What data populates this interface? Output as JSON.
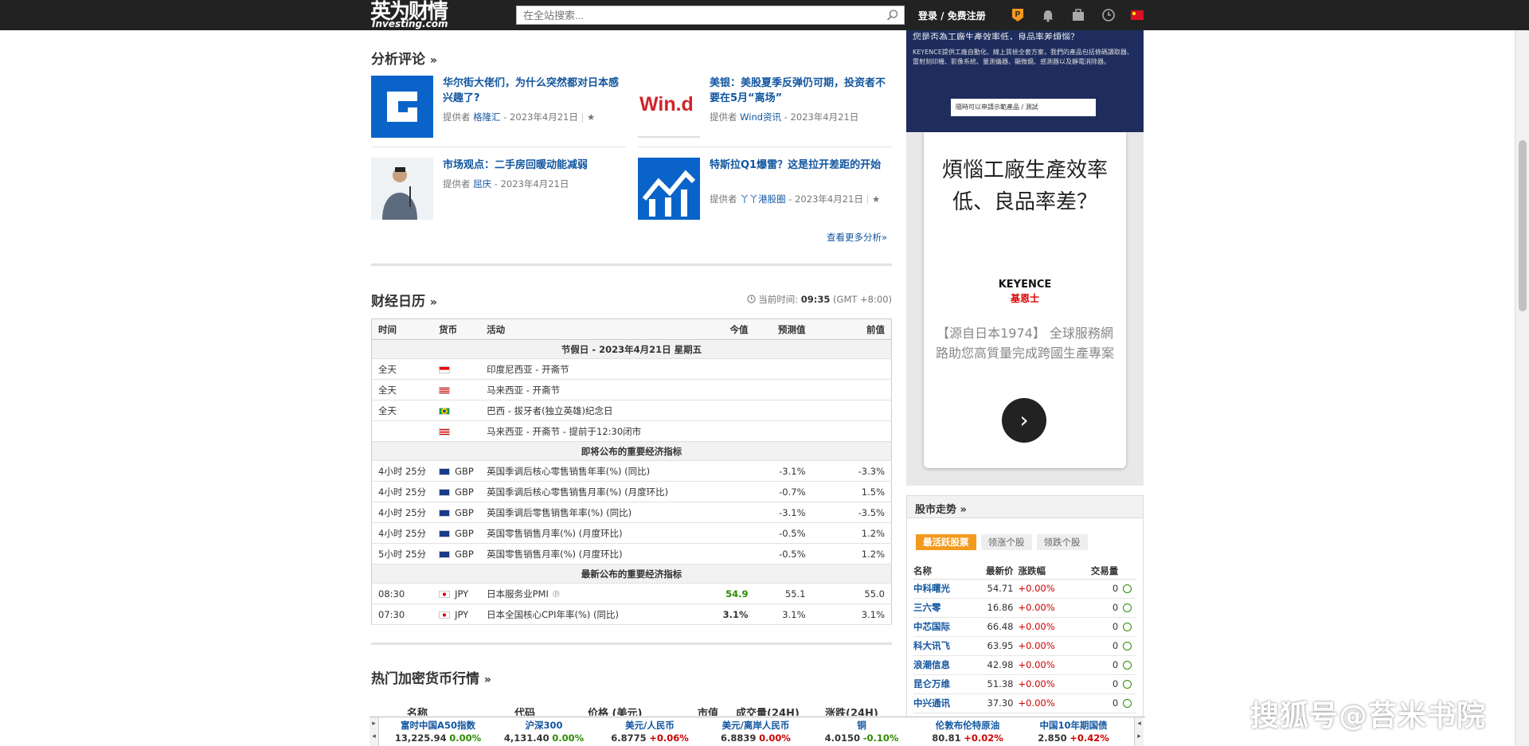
{
  "header": {
    "logo_cn": "英为财情",
    "logo_en": "Investing.com",
    "search_placeholder": "在全站搜索...",
    "login_label": "登录 / 免费注册"
  },
  "analysis": {
    "title": "分析评论",
    "arrow": "»",
    "more": "查看更多分析»",
    "articles": [
      {
        "title": "华尔街大佬们，为什么突然都对日本感兴趣了?",
        "by": "提供者",
        "author": "格隆汇",
        "date": " - 2023年4月21日",
        "thumb": "G"
      },
      {
        "title": "美银：美股夏季反弹仍可期，投资者不要在5月“离场”",
        "by": "提供者",
        "author": "Wind资讯",
        "date": " - 2023年4月21日",
        "thumb": "Win.d"
      },
      {
        "title": "市场观点：二手房回暖动能减弱",
        "by": "提供者",
        "author": "屈庆",
        "date": " - 2023年4月21日",
        "thumb": ""
      },
      {
        "title": "特斯拉Q1爆雷？这是拉开差距的开始",
        "by": "提供者",
        "author": "丫丫港股圈",
        "date": " - 2023年4月21日",
        "thumb": ""
      }
    ]
  },
  "calendar": {
    "title": "财经日历",
    "arrow": "»",
    "time_label": "当前时间: ",
    "time_value": "09:35",
    "tz": " (GMT +8:00)",
    "columns": [
      "时间",
      "货币",
      "活动",
      "今值",
      "预测值",
      "前值"
    ],
    "holiday_header": "节假日 - 2023年4月21日  星期五",
    "holidays": [
      {
        "time": "全天",
        "event": "印度尼西亚 - 开斋节",
        "flag": "id"
      },
      {
        "time": "全天",
        "event": "马来西亚 - 开斋节",
        "flag": "my"
      },
      {
        "time": "全天",
        "event": "巴西 - 拔牙者(独立英雄)纪念日",
        "flag": "br"
      },
      {
        "time": "",
        "event": "马来西亚 - 开斋节 - 提前于12:30闭市",
        "flag": "my"
      }
    ],
    "upcoming_header": "即将公布的重要经济指标",
    "upcoming": [
      {
        "time": "4小时 25分",
        "cur": "GBP",
        "event": "英国季调后核心零售销售年率(%) (同比)",
        "actual": "",
        "forecast": "-3.1%",
        "prev": "-3.3%"
      },
      {
        "time": "4小时 25分",
        "cur": "GBP",
        "event": "英国季调后核心零售销售月率(%) (月度环比)",
        "actual": "",
        "forecast": "-0.7%",
        "prev": "1.5%"
      },
      {
        "time": "4小时 25分",
        "cur": "GBP",
        "event": "英国季调后零售销售年率(%) (同比)",
        "actual": "",
        "forecast": "-3.1%",
        "prev": "-3.5%"
      },
      {
        "time": "4小时 25分",
        "cur": "GBP",
        "event": "英国零售销售月率(%) (月度环比)",
        "actual": "",
        "forecast": "-0.5%",
        "prev": "1.2%"
      },
      {
        "time": "5小时 25分",
        "cur": "GBP",
        "event": "英国零售销售月率(%) (月度环比)",
        "actual": "",
        "forecast": "-0.5%",
        "prev": "1.2%"
      }
    ],
    "latest_header": "最新公布的重要经济指标",
    "latest": [
      {
        "time": "08:30",
        "cur": "JPY",
        "event": "日本服务业PMI",
        "actual": "54.9",
        "forecast": "55.1",
        "prev": "55.0"
      },
      {
        "time": "07:30",
        "cur": "JPY",
        "event": "日本全国核心CPI年率(%) (同比)",
        "actual": "3.1%",
        "forecast": "3.1%",
        "prev": "3.1%"
      }
    ]
  },
  "crypto": {
    "title": "热门加密货币行情",
    "arrow": "»",
    "columns": [
      "名称",
      "代码",
      "价格 (美元)",
      "市值",
      "成交量(24H)",
      "涨跌(24H)"
    ]
  },
  "ad_top": {
    "headline": "您是否為工廠生產效率低，良品率差煩惱？",
    "text": "KEYENCE提供工廠自動化、線上質檢全套方案，我們的產品包括條碼讀取器、雷射刻印機、影像系統、量測儀器、顯微鏡、感測器以及靜電消除器。",
    "input": "隨時可以申請示範產品 / 測試"
  },
  "ad_main": {
    "headline": "煩惱工廠生產效率低、良品率差？",
    "brand": "KEYENCE",
    "brand_cn": "基恩士",
    "desc": "【源自日本1974】 全球服務網路助您高質量完成跨國生產專案",
    "go": "›"
  },
  "market": {
    "title": "股市走势",
    "arrow": "»",
    "tabs": [
      "最活跃股票",
      "领涨个股",
      "领跌个股"
    ],
    "columns": [
      "名称",
      "最新价",
      "涨跌幅",
      "交易量"
    ],
    "rows": [
      {
        "name": "中科曙光",
        "price": "54.71",
        "chg": "+0.00%",
        "vol": "0"
      },
      {
        "name": "三六零",
        "price": "16.86",
        "chg": "+0.00%",
        "vol": "0"
      },
      {
        "name": "中芯国际",
        "price": "66.48",
        "chg": "+0.00%",
        "vol": "0"
      },
      {
        "name": "科大讯飞",
        "price": "63.95",
        "chg": "+0.00%",
        "vol": "0"
      },
      {
        "name": "浪潮信息",
        "price": "42.98",
        "chg": "+0.00%",
        "vol": "0"
      },
      {
        "name": "昆仑万维",
        "price": "51.38",
        "chg": "+0.00%",
        "vol": "0"
      },
      {
        "name": "中兴通讯",
        "price": "37.30",
        "chg": "+0.00%",
        "vol": "0"
      }
    ]
  },
  "ticker": [
    {
      "name": "富时中国A50指数",
      "value": "13,225.94",
      "chg": "0.00%",
      "dir": "up"
    },
    {
      "name": "沪深300",
      "value": "4,131.40",
      "chg": "0.00%",
      "dir": "up"
    },
    {
      "name": "美元/人民币",
      "value": "6.8775",
      "chg": "+0.06%",
      "dir": "down"
    },
    {
      "name": "美元/离岸人民币",
      "value": "6.8839",
      "chg": "0.00%",
      "dir": "down"
    },
    {
      "name": "铜",
      "value": "4.0150",
      "chg": "-0.10%",
      "dir": "up"
    },
    {
      "name": "伦敦布伦特原油",
      "value": "80.81",
      "chg": "+0.02%",
      "dir": "down"
    },
    {
      "name": "中国10年期国债",
      "value": "2.850",
      "chg": "+0.42%",
      "dir": "down"
    }
  ],
  "watermark": "搜狐号@苔米书院",
  "colors": {
    "topbar": "#222222",
    "link": "#1256a0",
    "green": "#2d8a00",
    "red": "#cc0000",
    "tab_active": "#f39a1e",
    "ad_blue": "#1e2d5e"
  }
}
